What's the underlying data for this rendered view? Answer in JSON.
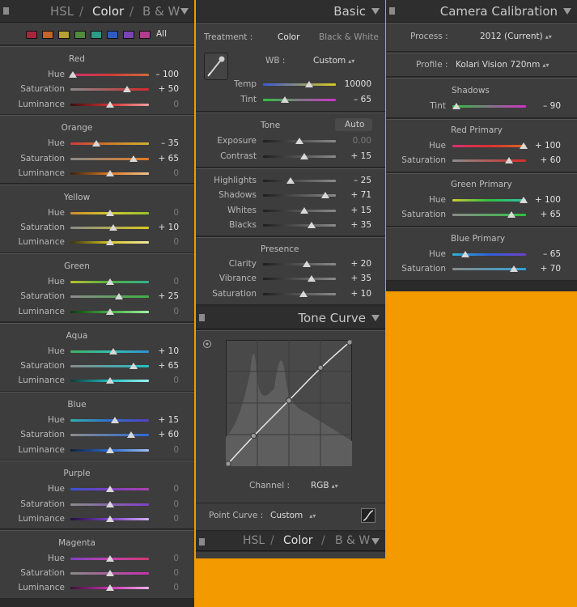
{
  "hsl_panel": {
    "title_hsl": "HSL",
    "title_color": "Color",
    "title_bw": "B & W",
    "sep1": "/",
    "sep2": "/",
    "all_label": "All",
    "swatches": [
      "#a8263d",
      "#c4632a",
      "#b8a133",
      "#4e8c3c",
      "#2c9b87",
      "#2e5cc2",
      "#7a44b3",
      "#b23c8e"
    ],
    "groups": [
      {
        "name": "Red",
        "rows": [
          {
            "label": "Hue",
            "value": "– 100",
            "level": 0.03,
            "zero": false,
            "grad": "linear-gradient(90deg,#c9326c,#d03a3a,#d06a3a)"
          },
          {
            "label": "Saturation",
            "value": "+ 50",
            "level": 0.72,
            "zero": false,
            "grad": "linear-gradient(90deg,#8a8a8a,#d22a2a)"
          },
          {
            "label": "Luminance",
            "value": "0",
            "level": 0.5,
            "zero": true,
            "grad": "linear-gradient(90deg,#3a1010,#d23030,#f0a0a0)"
          }
        ]
      },
      {
        "name": "Orange",
        "rows": [
          {
            "label": "Hue",
            "value": "– 35",
            "level": 0.33,
            "zero": false,
            "grad": "linear-gradient(90deg,#d03a3a,#d07a2a,#d0b030)"
          },
          {
            "label": "Saturation",
            "value": "+ 65",
            "level": 0.8,
            "zero": false,
            "grad": "linear-gradient(90deg,#8a8a8a,#e07a20)"
          },
          {
            "label": "Luminance",
            "value": "0",
            "level": 0.5,
            "zero": true,
            "grad": "linear-gradient(90deg,#3a2410,#e07a20,#f0c090)"
          }
        ]
      },
      {
        "name": "Yellow",
        "rows": [
          {
            "label": "Hue",
            "value": "0",
            "level": 0.5,
            "zero": true,
            "grad": "linear-gradient(90deg,#d08a2a,#d0c830,#9ac030)"
          },
          {
            "label": "Saturation",
            "value": "+ 10",
            "level": 0.55,
            "zero": false,
            "grad": "linear-gradient(90deg,#8a8a8a,#d8c820)"
          },
          {
            "label": "Luminance",
            "value": "0",
            "level": 0.5,
            "zero": true,
            "grad": "linear-gradient(90deg,#3a3410,#d8c820,#f0e8a0)"
          }
        ]
      },
      {
        "name": "Green",
        "rows": [
          {
            "label": "Hue",
            "value": "0",
            "level": 0.5,
            "zero": true,
            "grad": "linear-gradient(90deg,#b8c030,#50b040,#30b090)"
          },
          {
            "label": "Saturation",
            "value": "+ 25",
            "level": 0.62,
            "zero": false,
            "grad": "linear-gradient(90deg,#8a8a8a,#40b040)"
          },
          {
            "label": "Luminance",
            "value": "0",
            "level": 0.5,
            "zero": true,
            "grad": "linear-gradient(90deg,#103a10,#40b040,#a0f0a0)"
          }
        ]
      },
      {
        "name": "Aqua",
        "rows": [
          {
            "label": "Hue",
            "value": "+ 10",
            "level": 0.55,
            "zero": false,
            "grad": "linear-gradient(90deg,#40b060,#30c0b0,#3090d0)"
          },
          {
            "label": "Saturation",
            "value": "+ 65",
            "level": 0.8,
            "zero": false,
            "grad": "linear-gradient(90deg,#8a8a8a,#20c0c0)"
          },
          {
            "label": "Luminance",
            "value": "0",
            "level": 0.5,
            "zero": true,
            "grad": "linear-gradient(90deg,#103a3a,#20c0c0,#a0f0f0)"
          }
        ]
      },
      {
        "name": "Blue",
        "rows": [
          {
            "label": "Hue",
            "value": "+ 15",
            "level": 0.57,
            "zero": false,
            "grad": "linear-gradient(90deg,#30b0b0,#3070d0,#5040c0)"
          },
          {
            "label": "Saturation",
            "value": "+ 60",
            "level": 0.77,
            "zero": false,
            "grad": "linear-gradient(90deg,#8a8a8a,#2a6ad8)"
          },
          {
            "label": "Luminance",
            "value": "0",
            "level": 0.5,
            "zero": true,
            "grad": "linear-gradient(90deg,#10203a,#2a6ad8,#a0c0f0)"
          }
        ]
      },
      {
        "name": "Purple",
        "rows": [
          {
            "label": "Hue",
            "value": "0",
            "level": 0.5,
            "zero": true,
            "grad": "linear-gradient(90deg,#3a50d0,#7a40c0,#b040b0)"
          },
          {
            "label": "Saturation",
            "value": "0",
            "level": 0.5,
            "zero": true,
            "grad": "linear-gradient(90deg,#8a8a8a,#8040c8)"
          },
          {
            "label": "Luminance",
            "value": "0",
            "level": 0.5,
            "zero": true,
            "grad": "linear-gradient(90deg,#20103a,#8040c8,#d0b0f0)"
          }
        ]
      },
      {
        "name": "Magenta",
        "rows": [
          {
            "label": "Hue",
            "value": "0",
            "level": 0.5,
            "zero": true,
            "grad": "linear-gradient(90deg,#8040c0,#c040b0,#d03a70)"
          },
          {
            "label": "Saturation",
            "value": "0",
            "level": 0.5,
            "zero": true,
            "grad": "linear-gradient(90deg,#8a8a8a,#c830b0)"
          },
          {
            "label": "Luminance",
            "value": "0",
            "level": 0.5,
            "zero": true,
            "grad": "linear-gradient(90deg,#3a1034,#c830b0,#f0b0e8)"
          }
        ]
      }
    ]
  },
  "basic_panel": {
    "title": "Basic",
    "treatment_label": "Treatment :",
    "treatment_color": "Color",
    "treatment_bw": "Black & White",
    "wb_label": "WB :",
    "wb_value": "Custom",
    "temp": {
      "label": "Temp",
      "value": "10000",
      "level": 0.63
    },
    "tint": {
      "label": "Tint",
      "value": "– 65",
      "level": 0.3
    },
    "tone_label": "Tone",
    "auto_label": "Auto",
    "tone_rows": [
      {
        "label": "Exposure",
        "value": "0.00",
        "level": 0.5,
        "zero": true
      },
      {
        "label": "Contrast",
        "value": "+ 15",
        "level": 0.57,
        "zero": false
      }
    ],
    "hs_rows": [
      {
        "label": "Highlights",
        "value": "– 25",
        "level": 0.38,
        "zero": false
      },
      {
        "label": "Shadows",
        "value": "+ 71",
        "level": 0.85,
        "zero": false
      },
      {
        "label": "Whites",
        "value": "+ 15",
        "level": 0.57,
        "zero": false
      },
      {
        "label": "Blacks",
        "value": "+ 35",
        "level": 0.67,
        "zero": false
      }
    ],
    "presence_label": "Presence",
    "presence_rows": [
      {
        "label": "Clarity",
        "value": "+ 20",
        "level": 0.6,
        "zero": false
      },
      {
        "label": "Vibrance",
        "value": "+ 35",
        "level": 0.67,
        "zero": false
      },
      {
        "label": "Saturation",
        "value": "+ 10",
        "level": 0.55,
        "zero": false
      }
    ]
  },
  "tone_curve_panel": {
    "title": "Tone Curve",
    "channel_label": "Channel :",
    "channel_value": "RGB",
    "point_curve_label": "Point Curve :",
    "point_curve_value": "Custom",
    "curve_points": [
      [
        0,
        0
      ],
      [
        0.22,
        0.24
      ],
      [
        0.5,
        0.52
      ],
      [
        0.75,
        0.78
      ],
      [
        1,
        1
      ]
    ]
  },
  "bottom_tabs": {
    "hsl": "HSL",
    "color": "Color",
    "bw": "B & W",
    "sep1": "/",
    "sep2": "/"
  },
  "calibration_panel": {
    "title": "Camera Calibration",
    "process_label": "Process :",
    "process_value": "2012 (Current)",
    "profile_label": "Profile :",
    "profile_value": "Kolari Vision 720nm",
    "shadows_label": "Shadows",
    "shadows_tint": {
      "label": "Tint",
      "value": "– 90",
      "level": 0.05
    },
    "red_primary": {
      "name": "Red Primary",
      "hue": {
        "label": "Hue",
        "value": "+ 100",
        "level": 0.97
      },
      "sat": {
        "label": "Saturation",
        "value": "+ 60",
        "level": 0.77
      }
    },
    "green_primary": {
      "name": "Green Primary",
      "hue": {
        "label": "Hue",
        "value": "+ 100",
        "level": 0.97
      },
      "sat": {
        "label": "Saturation",
        "value": "+ 65",
        "level": 0.8
      }
    },
    "blue_primary": {
      "name": "Blue Primary",
      "hue": {
        "label": "Hue",
        "value": "– 65",
        "level": 0.18
      },
      "sat": {
        "label": "Saturation",
        "value": "+ 70",
        "level": 0.83
      }
    }
  }
}
